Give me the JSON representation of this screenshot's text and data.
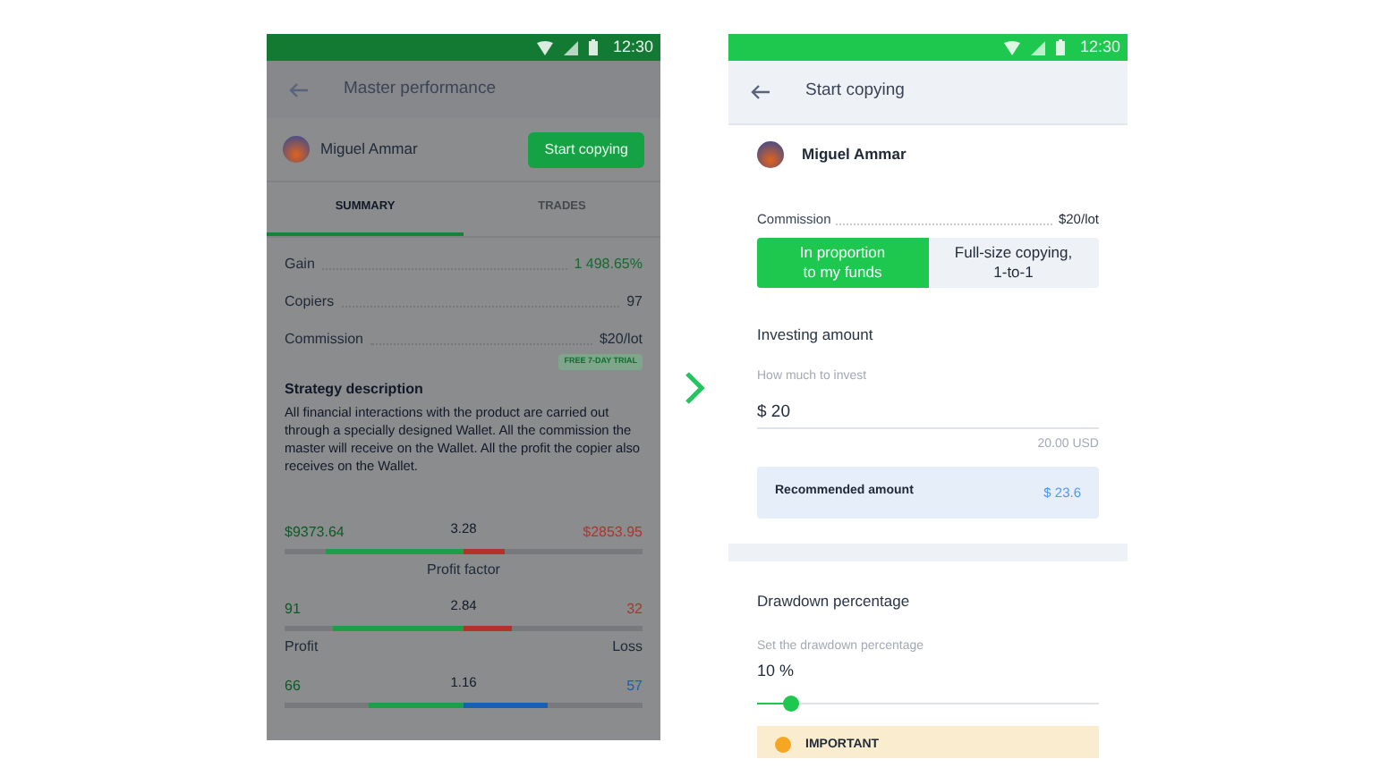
{
  "master_screen": {
    "status_time": "12:30",
    "title": "Master performance",
    "master_name": "Miguel Ammar",
    "start_button": "Start copying",
    "tabs": [
      {
        "label": "SUMMARY",
        "selected": true
      },
      {
        "label": "TRADES",
        "selected": false
      }
    ],
    "stats": [
      {
        "label": "Gain",
        "value": "1 498.65%",
        "kind": "positive"
      },
      {
        "label": "Copiers",
        "value": "97",
        "kind": "plain"
      },
      {
        "label": "Commission",
        "value": "$20/lot",
        "kind": "plain"
      }
    ],
    "trial_badge": "FREE 7-DAY TRIAL",
    "strategy_title": "Strategy description",
    "strategy_text": "All financial interactions with the product are carried out through a specially designed Wallet. All the commission the master will receive on the Wallet. All the profit the copier also receives on the Wallet.",
    "bars": [
      {
        "center": "3.28",
        "left_value": "$9373.64",
        "right_value": "$2853.95",
        "segments": [
          {
            "level": 0.77,
            "color": "#1e9e48"
          },
          {
            "level": 0.23,
            "color": "#b3322c"
          }
        ],
        "captions": [
          "Profit factor"
        ]
      },
      {
        "center": "2.84",
        "left_value": "91",
        "right_value": "32",
        "segments": [
          {
            "level": 0.73,
            "color": "#1e9e48"
          },
          {
            "level": 0.27,
            "color": "#b3322c"
          }
        ],
        "captions": [
          "Profit",
          "Loss"
        ]
      },
      {
        "center": "1.16",
        "left_value": "66",
        "right_value": "57",
        "segments": [
          {
            "level": 0.53,
            "color": "#1e9e48"
          },
          {
            "level": 0.47,
            "color": "#1a5fb4"
          }
        ]
      }
    ]
  },
  "copy_screen": {
    "status_time": "12:30",
    "title": "Start copying",
    "master_name": "Miguel Ammar",
    "commission": {
      "label": "Commission",
      "value": "$20/lot"
    },
    "modes": [
      {
        "label": "In proportion\nto my funds",
        "selected": true
      },
      {
        "label": "Full-size copying,\n1-to-1",
        "selected": false
      }
    ],
    "investing": {
      "title": "Investing amount",
      "field_label": "How much to invest",
      "value": "$ 20",
      "converted": "20.00 USD"
    },
    "recommended": {
      "label": "Recommended amount",
      "value": "$ 23.6"
    },
    "drawdown": {
      "title": "Drawdown percentage",
      "field_label": "Set the drawdown percentage",
      "value": "10 %",
      "level": 0.1
    },
    "notice": {
      "title": "IMPORTANT"
    }
  }
}
